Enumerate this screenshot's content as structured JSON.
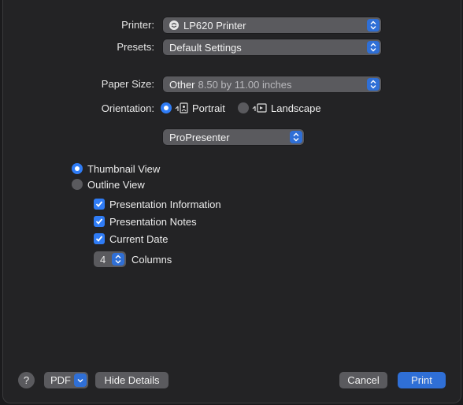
{
  "printer": {
    "label": "Printer:",
    "value": "LP620 Printer",
    "icon": "printer-icon"
  },
  "presets": {
    "label": "Presets:",
    "value": "Default Settings"
  },
  "paper_size": {
    "label": "Paper Size:",
    "value": "Other",
    "detail": "8.50 by 11.00 inches"
  },
  "orientation": {
    "label": "Orientation:",
    "options": [
      {
        "label": "Portrait",
        "selected": true,
        "icon": "portrait-icon"
      },
      {
        "label": "Landscape",
        "selected": false,
        "icon": "landscape-icon"
      }
    ]
  },
  "app_panel": {
    "value": "ProPresenter"
  },
  "view_mode": {
    "options": [
      {
        "label": "Thumbnail View",
        "selected": true
      },
      {
        "label": "Outline View",
        "selected": false
      }
    ]
  },
  "checkboxes": [
    {
      "label": "Presentation Information",
      "checked": true
    },
    {
      "label": "Presentation Notes",
      "checked": true
    },
    {
      "label": "Current Date",
      "checked": true
    }
  ],
  "columns": {
    "value": "4",
    "label": "Columns"
  },
  "footer": {
    "help": "?",
    "pdf": "PDF",
    "hide_details": "Hide Details",
    "cancel": "Cancel",
    "print": "Print"
  },
  "colors": {
    "accent": "#2f7cf6",
    "panel": "#232325",
    "control": "#5a5a5e"
  }
}
